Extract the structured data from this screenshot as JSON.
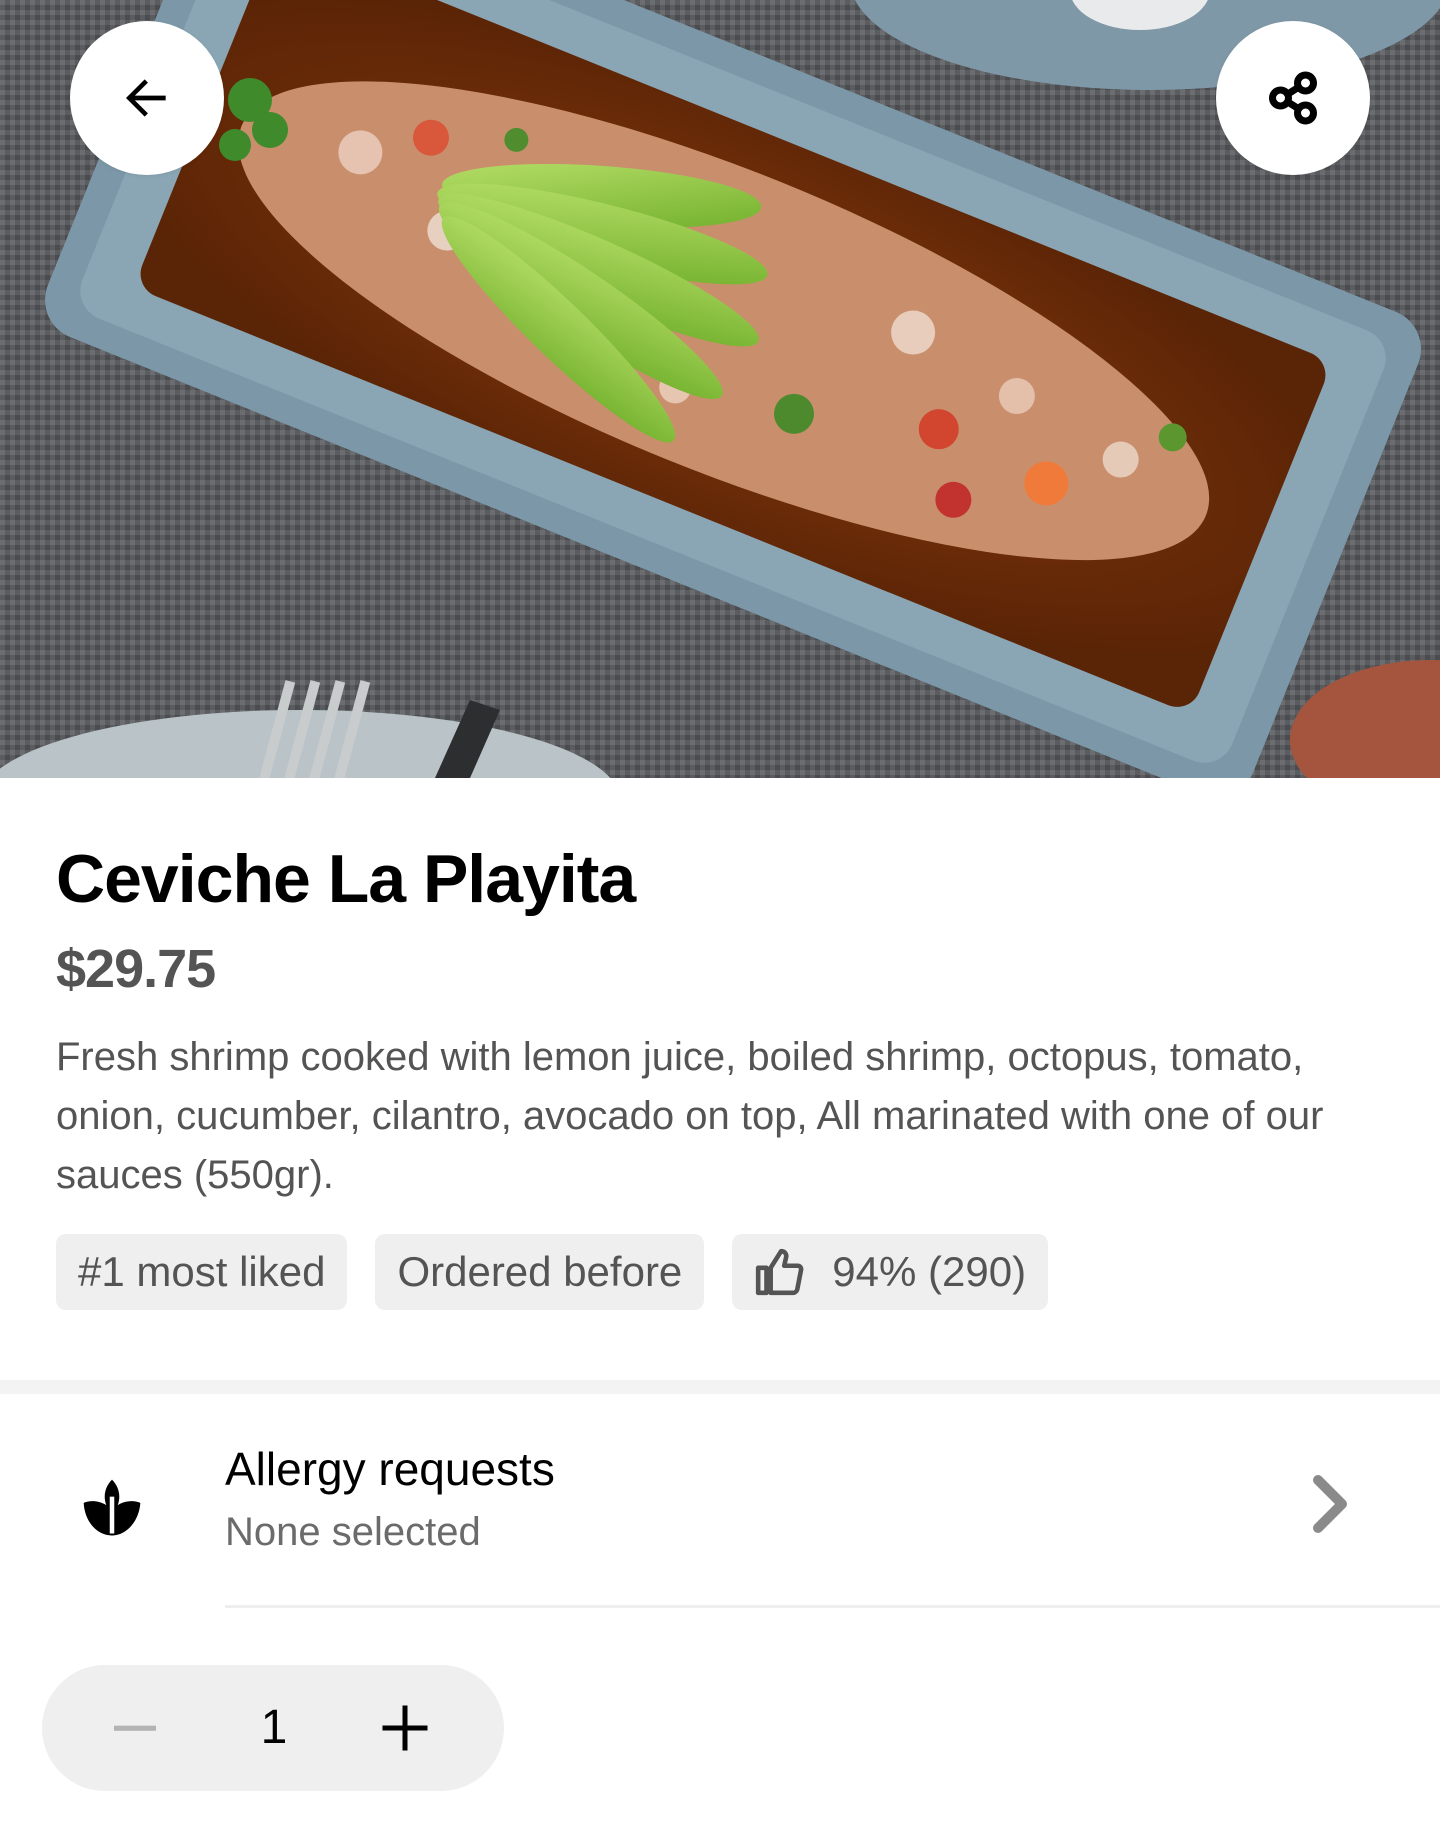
{
  "hero": {
    "image_alt": "Ceviche dish with avocado slices on a rectangular blue-grey plate",
    "back_icon": "arrow-left-icon",
    "share_icon": "share-icon"
  },
  "item": {
    "title": "Ceviche La Playita",
    "price": "$29.75",
    "description": "Fresh shrimp cooked with lemon juice, boiled shrimp, octopus, tomato, onion, cucumber, cilantro, avocado on top, All marinated with one of our sauces (550gr).",
    "badges": {
      "most_liked": "#1 most liked",
      "ordered_before": "Ordered before",
      "rating": "94% (290)"
    }
  },
  "allergy": {
    "title": "Allergy requests",
    "subtitle": "None selected",
    "icon": "leaf-icon"
  },
  "quantity": {
    "value": "1",
    "minus_icon": "minus-icon",
    "plus_icon": "plus-icon"
  },
  "colors": {
    "text_primary": "#000000",
    "text_secondary": "#545454",
    "chip_bg": "#efefef"
  }
}
